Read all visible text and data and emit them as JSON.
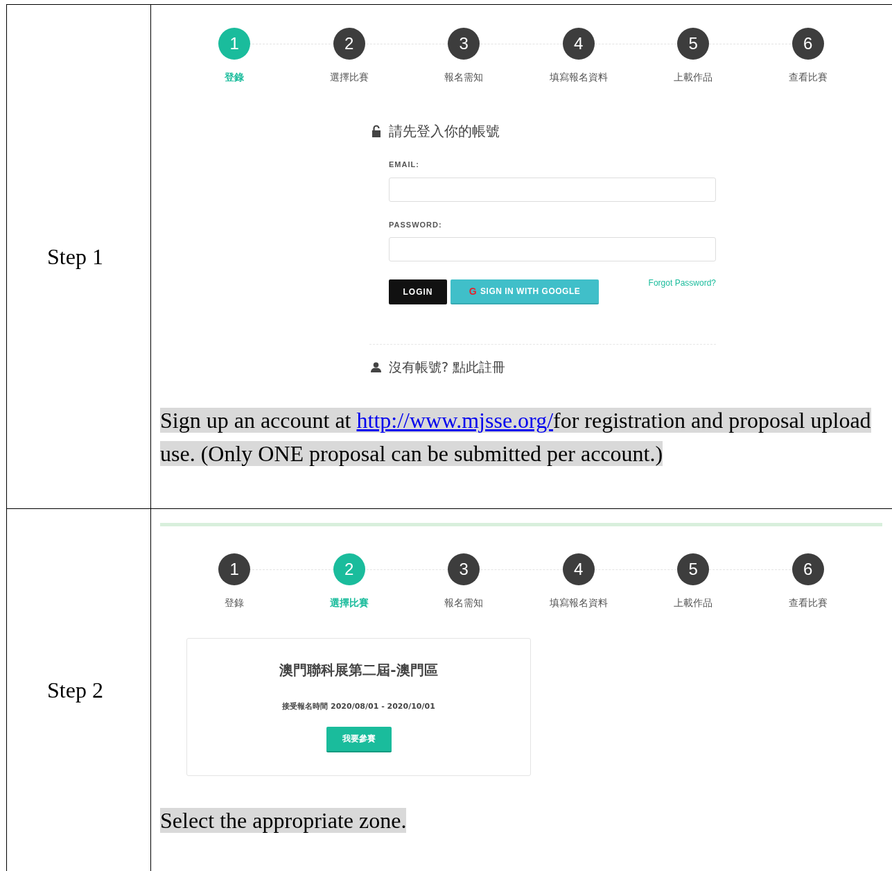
{
  "rows": [
    {
      "label": "Step 1",
      "kind": "login",
      "steps": [
        {
          "number": "1",
          "label": "登錄",
          "selected": true
        },
        {
          "number": "2",
          "label": "選擇比賽",
          "selected": false
        },
        {
          "number": "3",
          "label": "報名需知",
          "selected": false
        },
        {
          "number": "4",
          "label": "填寫報名資料",
          "selected": false
        },
        {
          "number": "5",
          "label": "上載作品",
          "selected": false
        },
        {
          "number": "6",
          "label": "查看比賽",
          "selected": false
        }
      ],
      "login": {
        "title": "請先登入你的帳號",
        "email_label": "EMAIL:",
        "password_label": "PASSWORD:",
        "login_button": "LOGIN",
        "google_button": "SIGN IN WITH GOOGLE",
        "google_mark": "G",
        "forgot_link": "Forgot Password?",
        "register_link": "沒有帳號? 點此註冊"
      },
      "caption": {
        "before": "Sign up an account at ",
        "link": "http://www.mjsse.org/",
        "after": "for registration and proposal upload use. (Only ONE proposal can be submitted per account.)"
      }
    },
    {
      "label": "Step 2",
      "kind": "competition",
      "steps": [
        {
          "number": "1",
          "label": "登錄",
          "selected": false
        },
        {
          "number": "2",
          "label": "選擇比賽",
          "selected": true
        },
        {
          "number": "3",
          "label": "報名需知",
          "selected": false
        },
        {
          "number": "4",
          "label": "填寫報名資料",
          "selected": false
        },
        {
          "number": "5",
          "label": "上載作品",
          "selected": false
        },
        {
          "number": "6",
          "label": "查看比賽",
          "selected": false
        }
      ],
      "competition": {
        "title": "澳門聯科展第二屆-澳門區",
        "period": "接受報名時間 2020/08/01 - 2020/10/01",
        "join_button": "我要參賽"
      },
      "caption": {
        "before": "Select the appropriate zone."
      }
    }
  ]
}
